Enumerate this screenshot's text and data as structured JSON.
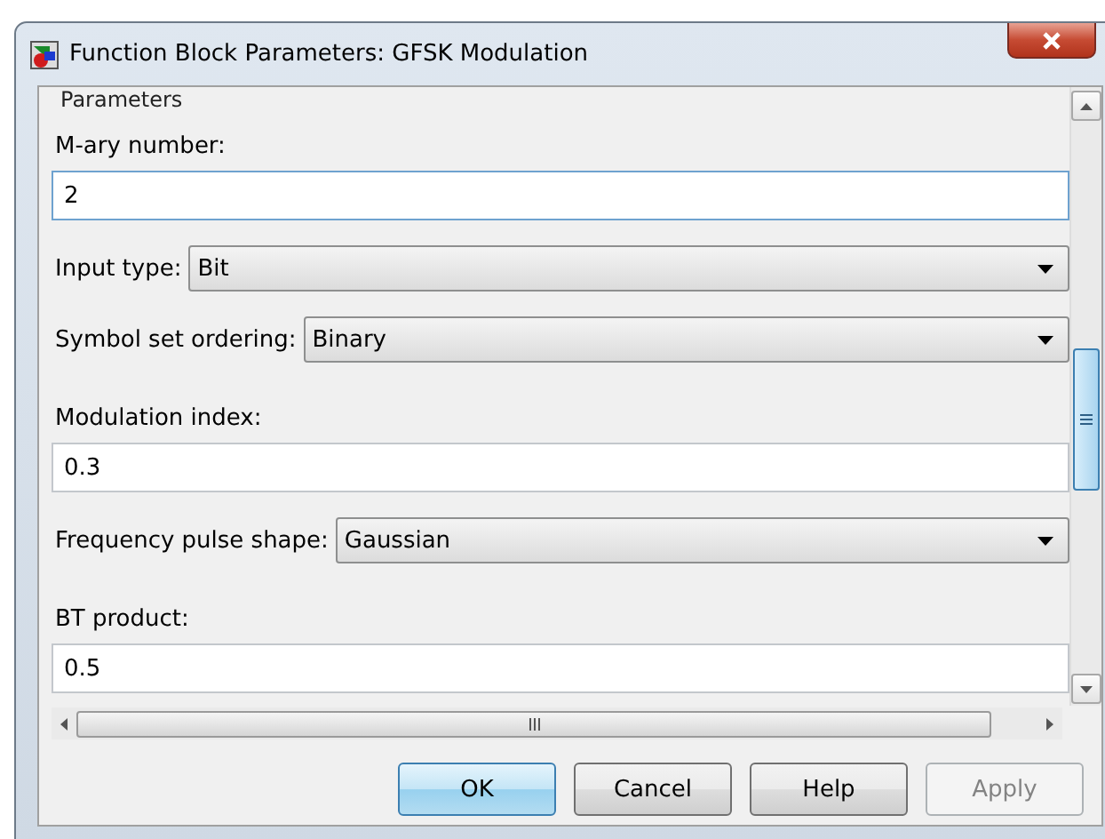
{
  "window": {
    "title": "Function Block Parameters: GFSK Modulation"
  },
  "section": "Parameters",
  "parameters": [
    {
      "kind": "text",
      "label": "M-ary number:",
      "value": "2",
      "focused": true
    },
    {
      "kind": "dropdown",
      "label": "Input type:",
      "value": "Bit"
    },
    {
      "kind": "dropdown",
      "label": "Symbol set ordering:",
      "value": "Binary"
    },
    {
      "kind": "text",
      "label": "Modulation index:",
      "value": "0.3",
      "focused": false
    },
    {
      "kind": "dropdown",
      "label": "Frequency pulse shape:",
      "value": "Gaussian"
    },
    {
      "kind": "text",
      "label": "BT product:",
      "value": "0.5",
      "focused": false
    }
  ],
  "buttons": [
    {
      "label": "OK",
      "focused": true,
      "disabled": false
    },
    {
      "label": "Cancel",
      "focused": false,
      "disabled": false
    },
    {
      "label": "Help",
      "focused": false,
      "disabled": false
    },
    {
      "label": "Apply",
      "focused": false,
      "disabled": true
    }
  ]
}
